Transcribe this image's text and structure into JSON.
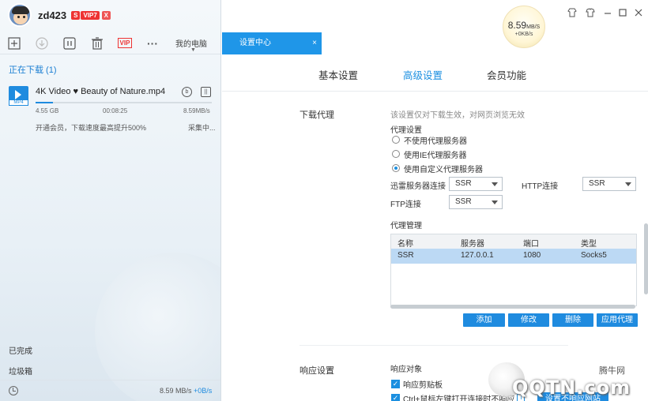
{
  "user": {
    "name": "zd423",
    "badge_dollar": "S",
    "badge_vip": "VIP7",
    "badge_x": "X"
  },
  "toolbar": {
    "icons": [
      "add-icon",
      "download-icon",
      "pause-icon",
      "trash-icon",
      "vip-icon",
      "more-icon"
    ],
    "vip_label": "VIP",
    "more_label": "···",
    "mypc_label": "我的电脑"
  },
  "downloading": {
    "title": "正在下载 (1)",
    "task": {
      "file_name": "4K Video ♥ Beauty of Nature.mp4",
      "format": "MP4",
      "size": "4.55 GB",
      "elapsed": "00:08:25",
      "speed": "8.59MB/s",
      "progress": 0.1,
      "promo": "开通会员，下载速度最高提升500%",
      "status": "采集中..."
    }
  },
  "nav": {
    "completed": "已完成",
    "trash": "垃圾箱"
  },
  "bottom": {
    "speed": "8.59 MB/s",
    "upload": "+0B/s"
  },
  "tab": {
    "label": "设置中心",
    "close": "×"
  },
  "speed_ball": {
    "speed": "8.59",
    "unit": "MB/S",
    "upload": "+0KB/s"
  },
  "window_controls": [
    "skin-icon",
    "shirt-icon",
    "minimize-icon",
    "maximize-icon",
    "close-icon"
  ],
  "settings_tabs": [
    "基本设置",
    "高级设置",
    "会员功能"
  ],
  "proxy": {
    "section": "下载代理",
    "note": "该设置仅对下载生效，对网页浏览无效",
    "settings_title": "代理设置",
    "options": [
      "不使用代理服务器",
      "使用IE代理服务器",
      "使用自定义代理服务器"
    ],
    "selected_index": 2,
    "thunder_label": "迅雷服务器连接",
    "thunder_value": "SSR",
    "http_label": "HTTP连接",
    "http_value": "SSR",
    "ftp_label": "FTP连接",
    "ftp_value": "SSR",
    "manage_title": "代理管理",
    "columns": [
      "名称",
      "服务器",
      "端口",
      "类型"
    ],
    "rows": [
      [
        "SSR",
        "127.0.0.1",
        "1080",
        "Socks5"
      ]
    ],
    "buttons": [
      "添加",
      "修改",
      "删除",
      "应用代理"
    ]
  },
  "response": {
    "section": "响应设置",
    "objects_title": "响应对象",
    "options": [
      "响应剪贴板",
      "Ctrl+鼠标左键打开连接时不响应"
    ],
    "info": "i",
    "button": "设置不响应网站"
  },
  "watermark": {
    "text": "腾牛网",
    "logo": "QQTN.com"
  },
  "colors": {
    "accent": "#1f8bdf",
    "tab_active": "#1f96e8",
    "selected_row": "#bcd9f4"
  }
}
